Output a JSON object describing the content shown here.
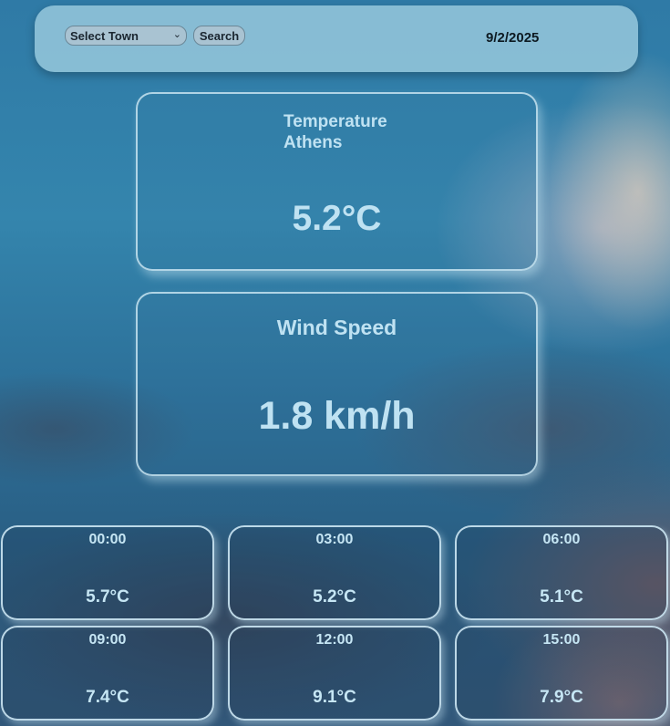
{
  "header": {
    "town_select": {
      "selected": "Select Town",
      "icon": "chevron-down-icon"
    },
    "search_label": "Search",
    "date": "9/2/2025"
  },
  "temperature_card": {
    "title": "Temperature",
    "city": "Athens",
    "value": "5.2°C"
  },
  "wind_card": {
    "title": "Wind Speed",
    "value": "1.8 km/h"
  },
  "forecast": [
    {
      "time": "00:00",
      "temp": "5.7°C"
    },
    {
      "time": "03:00",
      "temp": "5.2°C"
    },
    {
      "time": "06:00",
      "temp": "5.1°C"
    },
    {
      "time": "09:00",
      "temp": "7.4°C"
    },
    {
      "time": "12:00",
      "temp": "9.1°C"
    },
    {
      "time": "15:00",
      "temp": "7.9°C"
    }
  ],
  "colors": {
    "card_text": "#bfe2f2",
    "topbar": "#96c8dc",
    "date_text": "#0d1a22"
  }
}
